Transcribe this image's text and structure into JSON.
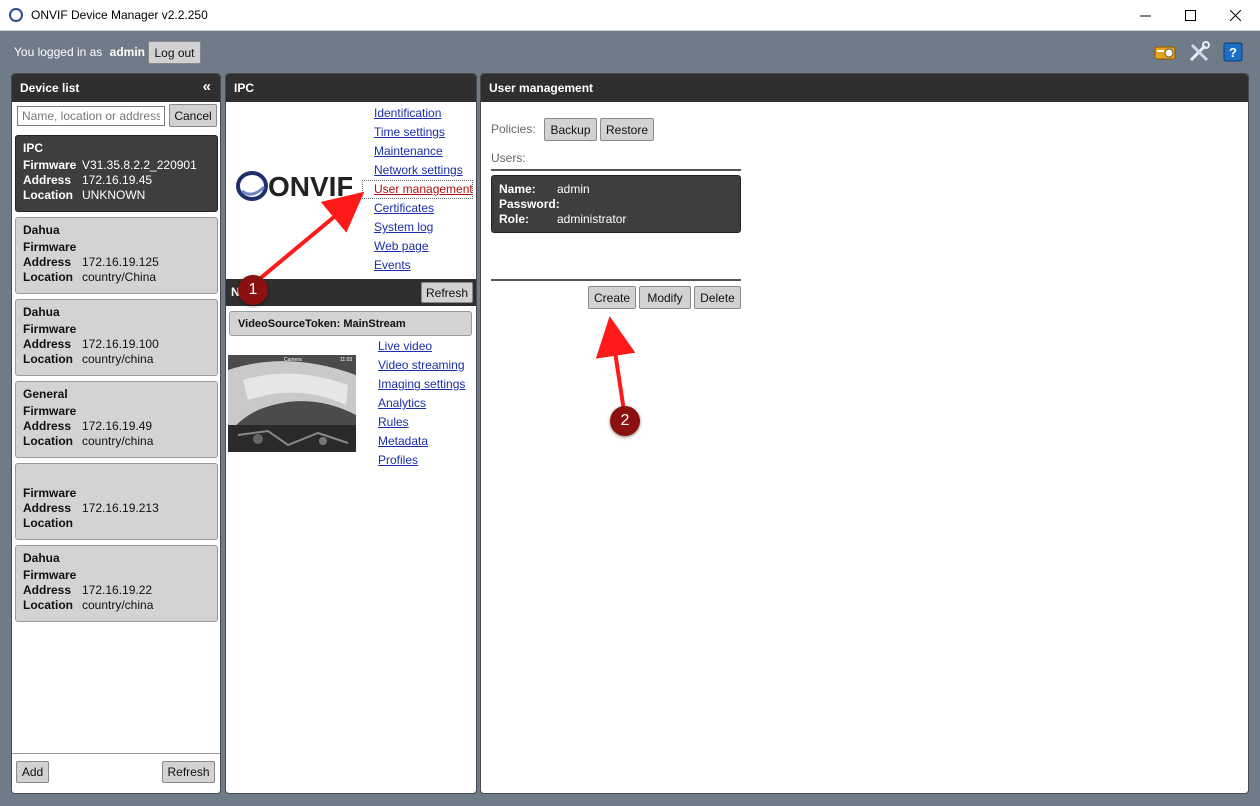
{
  "window": {
    "title": "ONVIF Device Manager v2.2.250",
    "controls": [
      "minimize",
      "maximize",
      "close"
    ]
  },
  "session": {
    "logged_prefix": "You logged in as",
    "user": "admin",
    "logout_label": "Log out"
  },
  "toolbar_icons": [
    "sdk-icon",
    "tools-icon",
    "help-icon"
  ],
  "device_list": {
    "title": "Device list",
    "search_placeholder": "Name, location or address",
    "cancel_label": "Cancel",
    "field_labels": {
      "firmware": "Firmware",
      "address": "Address",
      "location": "Location"
    },
    "devices": [
      {
        "name": "IPC",
        "firmware": "V31.35.8.2.2_220901",
        "address": "172.16.19.45",
        "location": "UNKNOWN",
        "selected": true
      },
      {
        "name": "Dahua",
        "firmware": "",
        "address": "172.16.19.125",
        "location": "country/China"
      },
      {
        "name": "Dahua",
        "firmware": "",
        "address": "172.16.19.100",
        "location": "country/china"
      },
      {
        "name": "General",
        "firmware": "",
        "address": "172.16.19.49",
        "location": "country/china"
      },
      {
        "name": "",
        "firmware": "",
        "address": "172.16.19.213",
        "location": ""
      },
      {
        "name": "Dahua",
        "firmware": "",
        "address": "172.16.19.22",
        "location": "country/china"
      }
    ],
    "add_label": "Add",
    "refresh_label": "Refresh"
  },
  "ipc": {
    "title": "IPC",
    "logo_text": "ONVIF",
    "device_links": [
      "Identification",
      "Time settings",
      "Maintenance",
      "Network settings",
      "User management",
      "Certificates",
      "System log",
      "Web page",
      "Events"
    ],
    "active_link": "User management",
    "nvt_title": "N",
    "refresh_label": "Refresh",
    "video_source": "VideoSourceToken: MainStream",
    "preview_overlay": "Camera",
    "preview_time": "11:03",
    "media_links": [
      "Live video",
      "Video streaming",
      "Imaging settings",
      "Analytics",
      "Rules",
      "Metadata",
      "Profiles"
    ]
  },
  "user_management": {
    "title": "User management",
    "policies_label": "Policies:",
    "backup_label": "Backup",
    "restore_label": "Restore",
    "users_label": "Users:",
    "field_labels": {
      "name": "Name:",
      "password": "Password:",
      "role": "Role:"
    },
    "user": {
      "name": "admin",
      "password": "",
      "role": "administrator"
    },
    "create_label": "Create",
    "modify_label": "Modify",
    "delete_label": "Delete"
  },
  "annotations": {
    "step1": "1",
    "step2": "2",
    "arrow_color": "#ff1a1a",
    "badge_color": "#8b1010"
  }
}
